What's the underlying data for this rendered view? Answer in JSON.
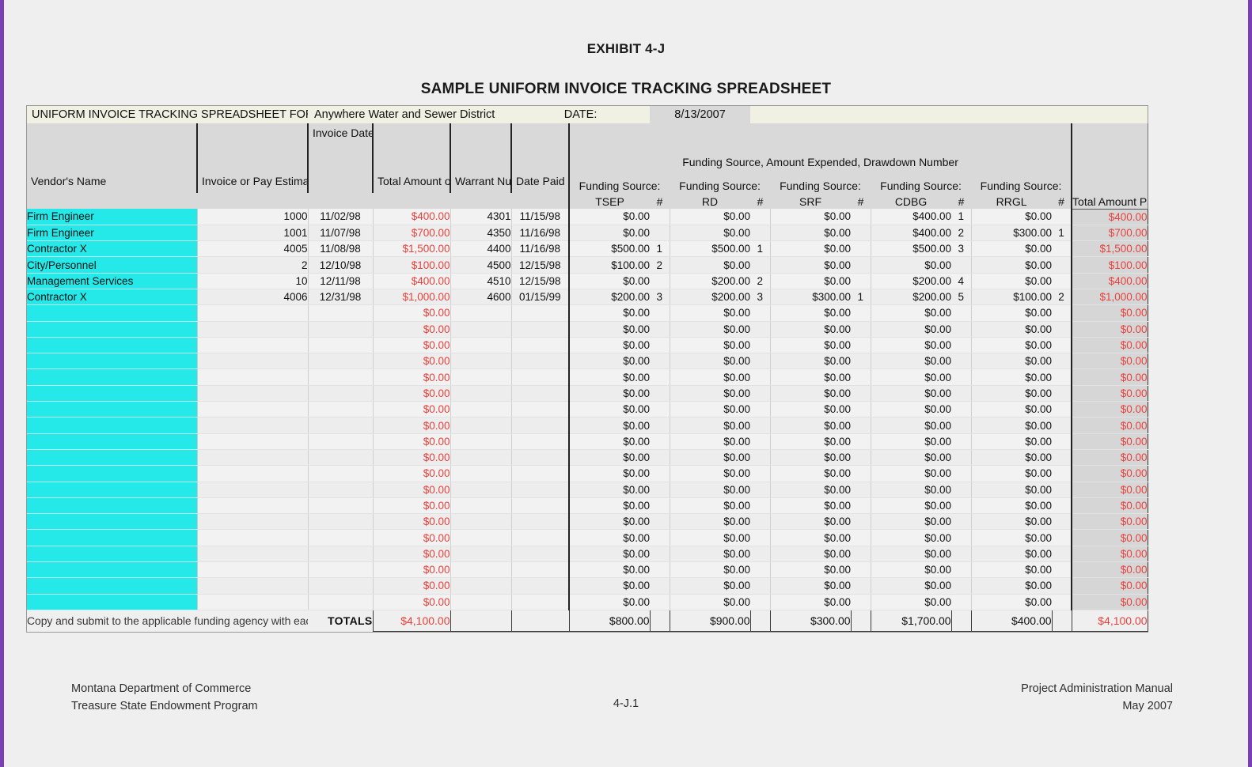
{
  "doc": {
    "exhibit": "EXHIBIT 4-J",
    "sample_title": "SAMPLE UNIFORM INVOICE TRACKING SPREADSHEET"
  },
  "banner": {
    "label": "UNIFORM INVOICE TRACKING SPREADSHEET FOR:",
    "entity": "Anywhere Water and Sewer District",
    "date_label": "DATE:",
    "date_value": "8/13/2007"
  },
  "headers": {
    "vendor": "Vendor's Name",
    "invoice_number": "Invoice or Pay Estimate Number",
    "invoice_date": "Invoice Date or Time Period Covered",
    "total_invoice": "Total Amount of Invoice",
    "warrant": "Warrant Number",
    "date_paid": "Date Paid",
    "funding_group": "Funding Source, Amount Expended, Drawdown Number",
    "funding_prefix": "Funding Source:",
    "hash": "#",
    "total_paid": "Total Amount Paid This Invoice",
    "sources": [
      "TSEP",
      "RD",
      "SRF",
      "CDBG",
      "RRGL"
    ]
  },
  "rows": [
    {
      "vendor": "Firm Engineer",
      "invoice_number": "1000",
      "invoice_date": "11/02/98",
      "total_invoice": "$400.00",
      "warrant": "4301",
      "date_paid": "11/15/98",
      "tsep": "$0.00",
      "tsep_n": "",
      "rd": "$0.00",
      "rd_n": "",
      "srf": "$0.00",
      "srf_n": "",
      "cdbg": "$400.00",
      "cdbg_n": "1",
      "rrgl": "$0.00",
      "rrgl_n": "",
      "total_paid": "$400.00"
    },
    {
      "vendor": "Firm Engineer",
      "invoice_number": "1001",
      "invoice_date": "11/07/98",
      "total_invoice": "$700.00",
      "warrant": "4350",
      "date_paid": "11/16/98",
      "tsep": "$0.00",
      "tsep_n": "",
      "rd": "$0.00",
      "rd_n": "",
      "srf": "$0.00",
      "srf_n": "",
      "cdbg": "$400.00",
      "cdbg_n": "2",
      "rrgl": "$300.00",
      "rrgl_n": "1",
      "total_paid": "$700.00"
    },
    {
      "vendor": "Contractor X",
      "invoice_number": "4005",
      "invoice_date": "11/08/98",
      "total_invoice": "$1,500.00",
      "warrant": "4400",
      "date_paid": "11/16/98",
      "tsep": "$500.00",
      "tsep_n": "1",
      "rd": "$500.00",
      "rd_n": "1",
      "srf": "$0.00",
      "srf_n": "",
      "cdbg": "$500.00",
      "cdbg_n": "3",
      "rrgl": "$0.00",
      "rrgl_n": "",
      "total_paid": "$1,500.00"
    },
    {
      "vendor": "City/Personnel",
      "invoice_number": "2",
      "invoice_date": "12/10/98",
      "total_invoice": "$100.00",
      "warrant": "4500",
      "date_paid": "12/15/98",
      "tsep": "$100.00",
      "tsep_n": "2",
      "rd": "$0.00",
      "rd_n": "",
      "srf": "$0.00",
      "srf_n": "",
      "cdbg": "$0.00",
      "cdbg_n": "",
      "rrgl": "$0.00",
      "rrgl_n": "",
      "total_paid": "$100.00"
    },
    {
      "vendor": "Management Services",
      "invoice_number": "10",
      "invoice_date": "12/11/98",
      "total_invoice": "$400.00",
      "warrant": "4510",
      "date_paid": "12/15/98",
      "tsep": "$0.00",
      "tsep_n": "",
      "rd": "$200.00",
      "rd_n": "2",
      "srf": "$0.00",
      "srf_n": "",
      "cdbg": "$200.00",
      "cdbg_n": "4",
      "rrgl": "$0.00",
      "rrgl_n": "",
      "total_paid": "$400.00"
    },
    {
      "vendor": "Contractor X",
      "invoice_number": "4006",
      "invoice_date": "12/31/98",
      "total_invoice": "$1,000.00",
      "warrant": "4600",
      "date_paid": "01/15/99",
      "tsep": "$200.00",
      "tsep_n": "3",
      "rd": "$200.00",
      "rd_n": "3",
      "srf": "$300.00",
      "srf_n": "1",
      "cdbg": "$200.00",
      "cdbg_n": "5",
      "rrgl": "$100.00",
      "rrgl_n": "2",
      "total_paid": "$1,000.00"
    }
  ],
  "empty_row_count": 19,
  "empty_row_values": {
    "vendor": "",
    "invoice_number": "",
    "invoice_date": "",
    "total_invoice": "$0.00",
    "warrant": "",
    "date_paid": "",
    "tsep": "$0.00",
    "tsep_n": "",
    "rd": "$0.00",
    "rd_n": "",
    "srf": "$0.00",
    "srf_n": "",
    "cdbg": "$0.00",
    "cdbg_n": "",
    "rrgl": "$0.00",
    "rrgl_n": "",
    "total_paid": "$0.00"
  },
  "totals": {
    "note": "Copy and submit to the applicable funding agency with each drawdown request.",
    "label": "TOTALS",
    "total_invoice": "$4,100.00",
    "warrant": "",
    "date_paid": "",
    "tsep": "$800.00",
    "rd": "$900.00",
    "srf": "$300.00",
    "cdbg": "$1,700.00",
    "rrgl": "$400.00",
    "total_paid": "$4,100.00"
  },
  "footer": {
    "left_line1": "Montana Department of Commerce",
    "left_line2": "Treasure State Endowment Program",
    "center": "4-J.1",
    "right_line1": "Project Administration Manual",
    "right_line2": "May 2007"
  },
  "colors": {
    "vendor_highlight": "#25e9e9",
    "money_red": "#e8413c",
    "banner_bg": "#f0f0e3",
    "header_bg": "#d9d9d9",
    "page_border": "#7b3fb5"
  }
}
